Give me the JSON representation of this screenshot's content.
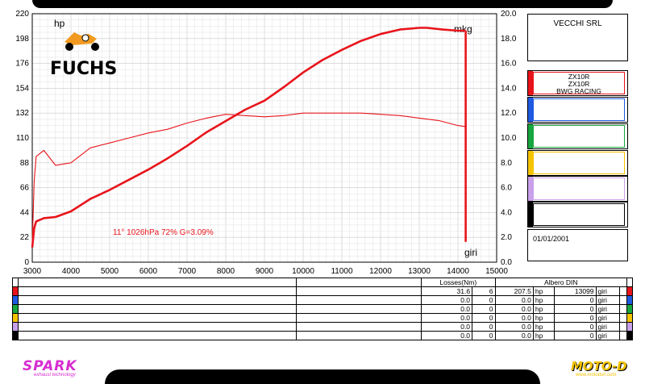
{
  "chart_data": {
    "type": "line",
    "left_unit": "hp",
    "right_unit": "mkg",
    "x_unit": "giri",
    "xlim": [
      3000,
      15000
    ],
    "ylim_left": [
      0,
      220
    ],
    "ylim_right": [
      0,
      20
    ],
    "x_ticks": [
      3000,
      4000,
      5000,
      6000,
      7000,
      8000,
      9000,
      10000,
      11000,
      12000,
      13000,
      14000,
      15000
    ],
    "y_ticks_left": [
      "0",
      "22",
      "44",
      "66",
      "88",
      "110",
      "132",
      "154",
      "176",
      "198",
      "220"
    ],
    "y_ticks_right": [
      "0.0",
      "2.0",
      "4.0",
      "6.0",
      "8.0",
      "10.0",
      "12.0",
      "14.0",
      "16.0",
      "18.0",
      "20.0"
    ],
    "grid": true,
    "annotation": "11°  1026hPa  72%   G=3.09%",
    "series": [
      {
        "axis": "left",
        "color": "#e8141b",
        "x": [
          3000,
          3050,
          3100,
          3300,
          3600,
          4000,
          4500,
          5000,
          5500,
          6000,
          6500,
          7000,
          7500,
          8000,
          8500,
          9000,
          9500,
          10000,
          10500,
          11000,
          11500,
          12000,
          12500,
          13000,
          13200,
          13600,
          14000,
          14200
        ],
        "values": [
          13,
          30,
          36,
          39,
          40,
          45,
          56,
          64,
          73,
          82,
          92,
          103,
          115,
          125,
          135,
          143,
          155,
          168,
          179,
          188,
          196,
          202,
          206,
          207.5,
          207.5,
          206,
          205,
          205
        ]
      },
      {
        "axis": "right",
        "color": "#e8141b",
        "x": [
          3000,
          3050,
          3100,
          3300,
          3600,
          4000,
          4500,
          5000,
          5500,
          6000,
          6500,
          7000,
          7500,
          8000,
          8500,
          9000,
          9500,
          10000,
          10500,
          11000,
          11500,
          12000,
          12500,
          13000,
          13500,
          14000,
          14200
        ],
        "values": [
          1.5,
          6.5,
          8.5,
          9.0,
          7.8,
          8.0,
          9.2,
          9.6,
          10.0,
          10.4,
          10.7,
          11.2,
          11.6,
          11.9,
          11.8,
          11.7,
          11.8,
          12.0,
          12.0,
          12.0,
          12.0,
          11.9,
          11.8,
          11.6,
          11.4,
          11.0,
          10.9
        ]
      }
    ]
  },
  "legend": {
    "company": "VECCHI SRL",
    "runs": [
      {
        "color": "#e8141b",
        "lines": [
          "ZX10R",
          "ZX10R",
          "BWG RACING"
        ]
      },
      {
        "color": "#1f5ae0",
        "lines": []
      },
      {
        "color": "#18a640",
        "lines": []
      },
      {
        "color": "#f5c400",
        "lines": []
      },
      {
        "color": "#c9a0ea",
        "lines": []
      },
      {
        "color": "#000000",
        "lines": []
      }
    ],
    "date": "01/01/2001"
  },
  "brand": {
    "logo_text": "FUCHS",
    "logo_color": "#f29a1f",
    "left_footer": "SPARK",
    "left_footer_sub": "exhaust technology",
    "right_footer": "MOTO-D",
    "right_footer_sub": "www.motodsrl.com"
  },
  "table": {
    "header_losses": "Losses(Nm)",
    "header_albero": "Albero DIN",
    "rows": [
      {
        "color": "#e8141b",
        "loss": "31.6",
        "loss2": "6",
        "hp": "207.5",
        "hp_unit": "hp",
        "rpm": "13099",
        "rpm_unit": "giri"
      },
      {
        "color": "#1f5ae0",
        "loss": "0.0",
        "loss2": "0",
        "hp": "0.0",
        "hp_unit": "hp",
        "rpm": "0",
        "rpm_unit": "giri"
      },
      {
        "color": "#18a640",
        "loss": "0.0",
        "loss2": "0",
        "hp": "0.0",
        "hp_unit": "hp",
        "rpm": "0",
        "rpm_unit": "giri"
      },
      {
        "color": "#f5c400",
        "loss": "0.0",
        "loss2": "0",
        "hp": "0.0",
        "hp_unit": "hp",
        "rpm": "0",
        "rpm_unit": "giri"
      },
      {
        "color": "#c9a0ea",
        "loss": "0.0",
        "loss2": "0",
        "hp": "0.0",
        "hp_unit": "hp",
        "rpm": "0",
        "rpm_unit": "giri"
      },
      {
        "color": "#000000",
        "loss": "0.0",
        "loss2": "0",
        "hp": "0.0",
        "hp_unit": "hp",
        "rpm": "0",
        "rpm_unit": "giri"
      }
    ]
  }
}
